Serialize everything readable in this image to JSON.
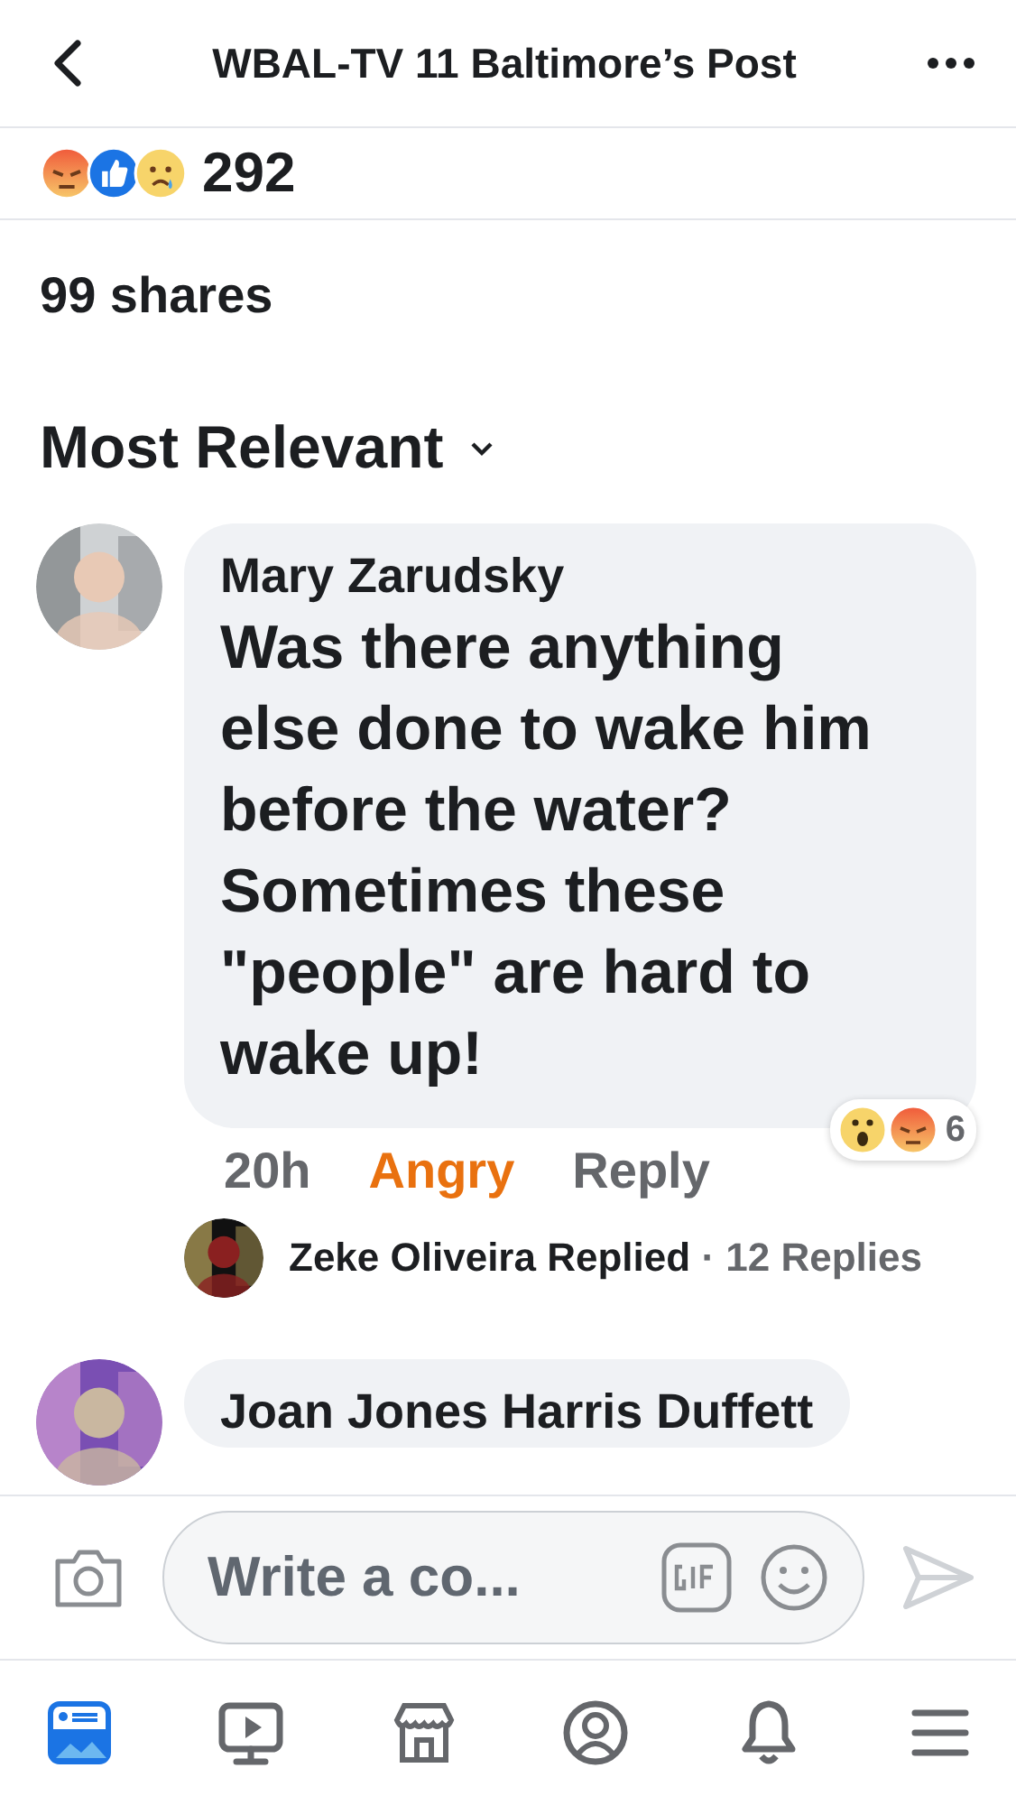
{
  "header": {
    "title": "WBAL-TV 11 Baltimore’s Post"
  },
  "reactions": {
    "icons": [
      {
        "kind": "angry"
      },
      {
        "kind": "like"
      },
      {
        "kind": "sad"
      }
    ],
    "count": "292"
  },
  "shares": "99 shares",
  "sort": {
    "label": "Most Relevant"
  },
  "comments": [
    {
      "author": "Mary Zarudsky",
      "text": "Was there anything else done to wake him before the water? Sometimes these \"people\" are hard to wake up!",
      "time": "20h",
      "my_reaction": {
        "label": "Angry",
        "kind": "angry"
      },
      "reply_label": "Reply",
      "reactions": {
        "icons": [
          {
            "kind": "wow"
          },
          {
            "kind": "angry"
          }
        ],
        "count": "6"
      },
      "replies": {
        "author": "Zeke Oliveira",
        "verb": "Replied",
        "count": "· 12 Replies"
      }
    },
    {
      "author": "Joan Jones Harris Duffett"
    }
  ],
  "composer": {
    "placeholder": "Write a co..."
  },
  "tabs": [
    {
      "kind": "feed",
      "selected": true
    },
    {
      "kind": "video",
      "selected": false
    },
    {
      "kind": "market",
      "selected": false
    },
    {
      "kind": "profile",
      "selected": false
    },
    {
      "kind": "bell",
      "selected": false
    },
    {
      "kind": "menu",
      "selected": false
    }
  ]
}
